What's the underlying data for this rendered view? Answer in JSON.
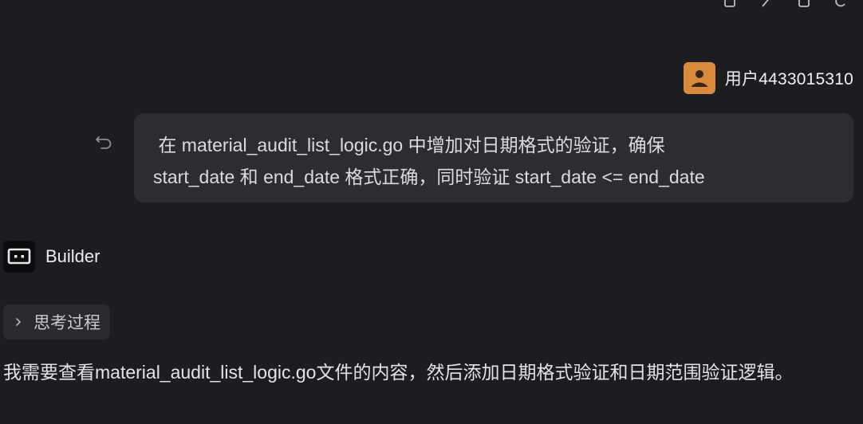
{
  "toolbar": {
    "icons": [
      "copy-icon",
      "edit-icon",
      "bookmark-icon",
      "refresh-icon"
    ]
  },
  "user": {
    "name": "用户4433015310",
    "message_lines": [
      " 在 material_audit_list_logic.go 中增加对日期格式的验证，确保",
      "start_date 和 end_date 格式正确，同时验证 start_date <= end_date"
    ]
  },
  "assistant": {
    "name": "Builder",
    "thinking_label": "思考过程",
    "reply": "我需要查看material_audit_list_logic.go文件的内容，然后添加日期格式验证和日期范围验证逻辑。"
  },
  "colors": {
    "background": "#1d1d21",
    "bubble": "#2c2c31",
    "avatar": "#d98a3d"
  }
}
